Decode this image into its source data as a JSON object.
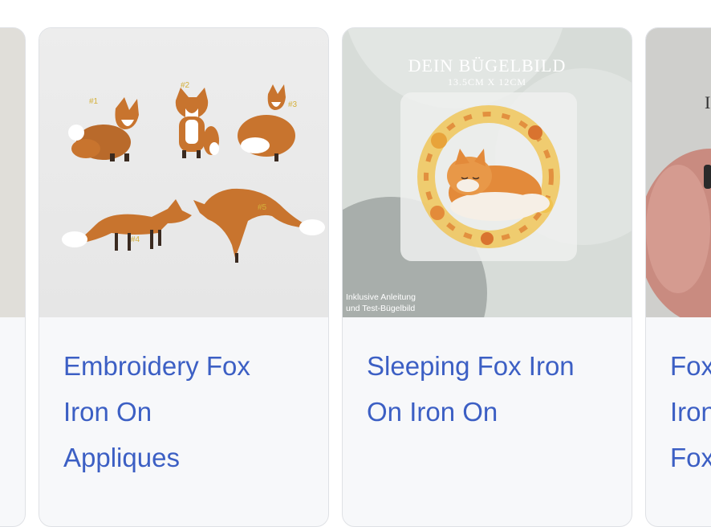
{
  "cards": [
    {
      "title": ""
    },
    {
      "title_line1": "Embroidery Fox",
      "title_line2": "Iron On",
      "title_line3": "Appliques",
      "patch_labels": [
        "#1",
        "#2",
        "#3",
        "#4",
        "#5"
      ]
    },
    {
      "title_line1": "Sleeping Fox Iron",
      "title_line2": "On Iron On",
      "overlay_title": "DEIN BÜGELBILD",
      "overlay_subtitle": "13.5CM X 12CM",
      "overlay_note_line1": "Inklusive Anleitung",
      "overlay_note_line2": "und Test-Bügelbild"
    },
    {
      "title_line1": "Fox",
      "title_line2": "Iron",
      "title_line3": "Fox",
      "overlay_letter": "I"
    }
  ],
  "colors": {
    "title_link": "#3c5fc4",
    "card_bg": "#f7f8fa",
    "card_border": "#dfe1e5",
    "fox_orange": "#c8742e"
  }
}
